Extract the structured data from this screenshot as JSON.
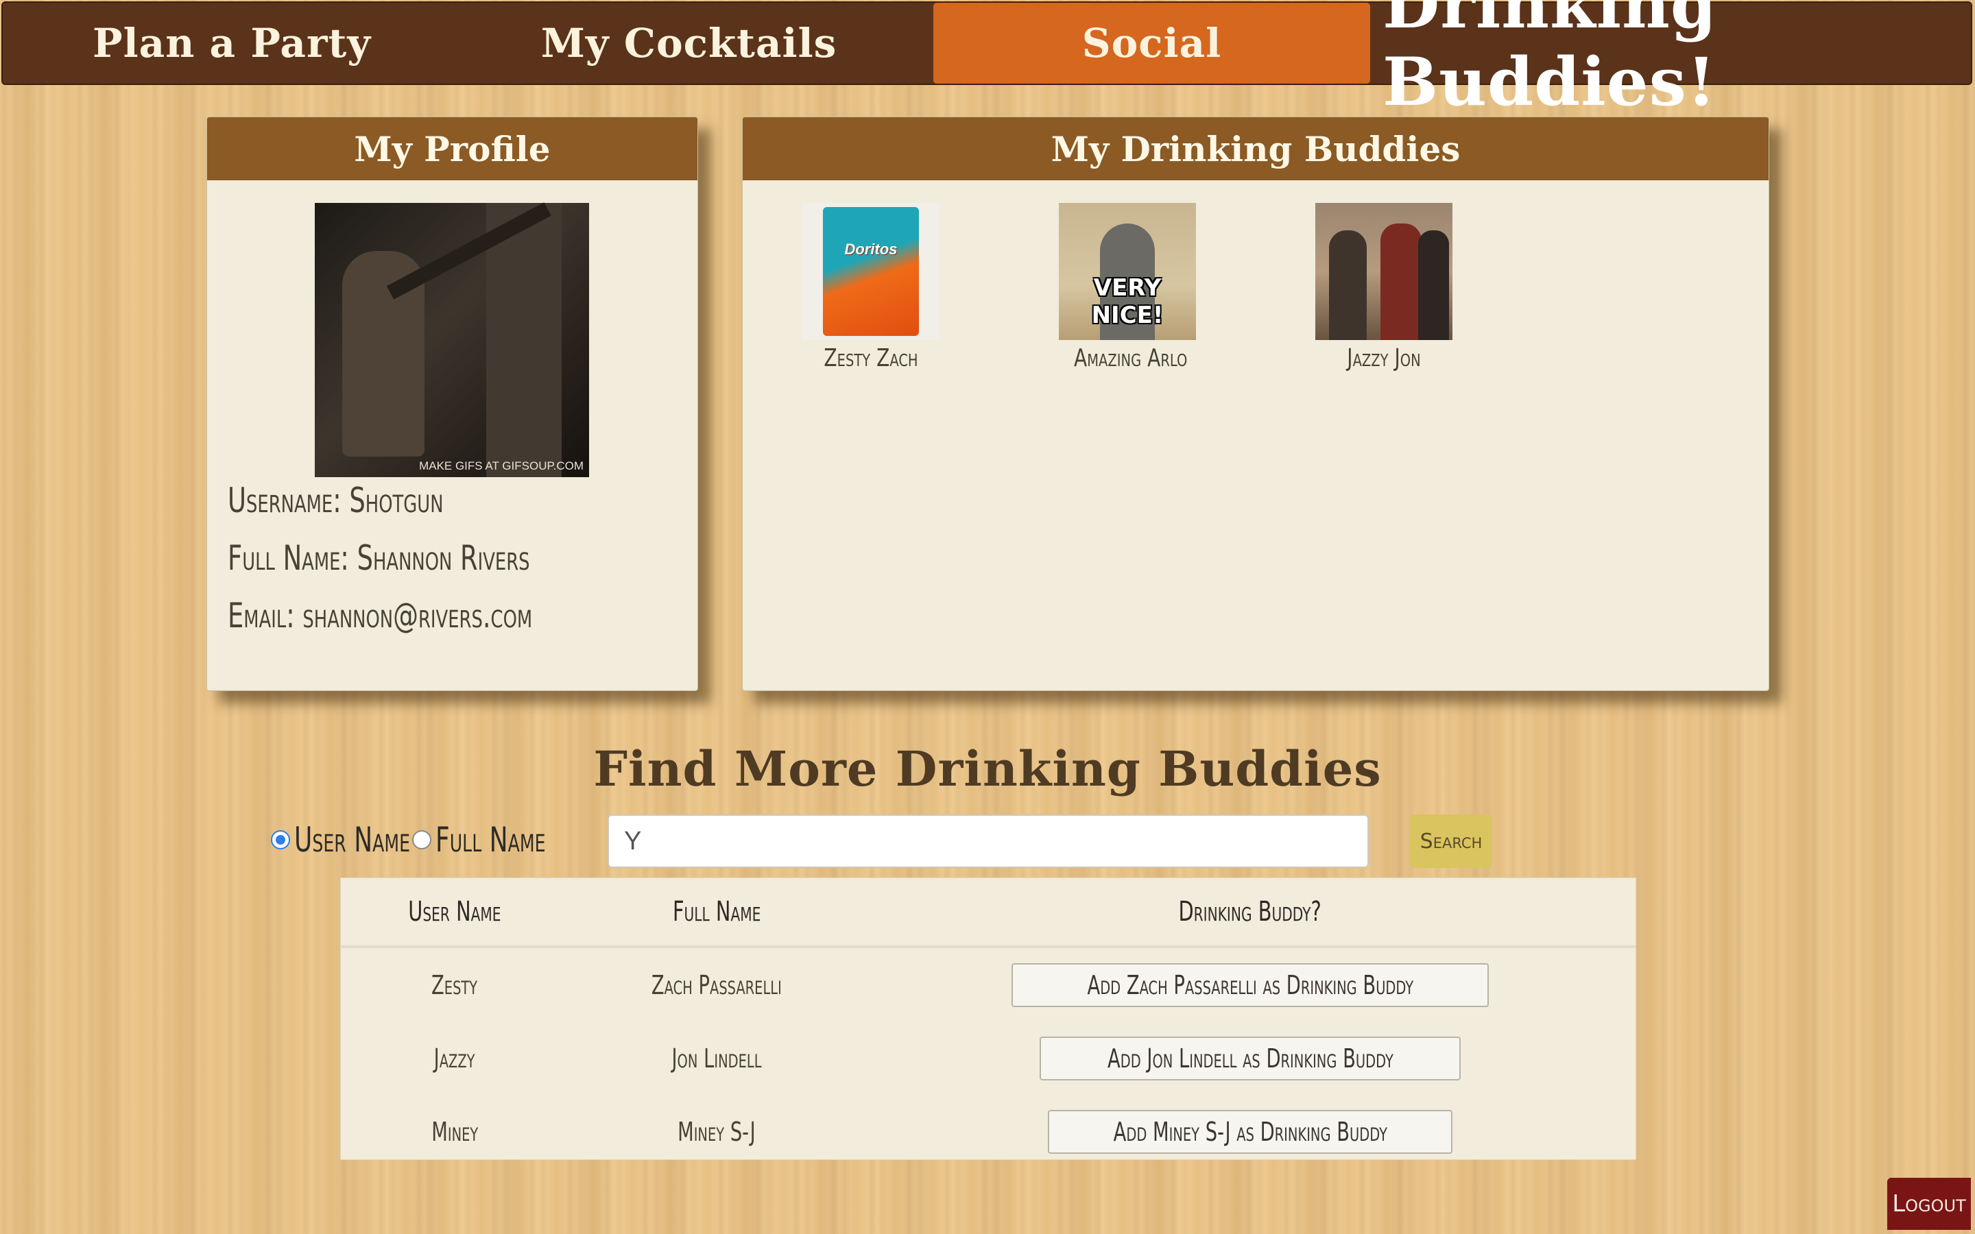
{
  "nav": {
    "items": [
      {
        "label": "Plan a Party"
      },
      {
        "label": "My Cocktails"
      },
      {
        "label": "Social",
        "active": true
      }
    ],
    "brand": "Drinking Buddies!"
  },
  "profile": {
    "title": "My Profile",
    "image_caption": "MAKE GIFS AT GIFSOUP.COM",
    "username_line": "Username: Shotgun",
    "fullname_line": "Full Name: Shannon Rivers",
    "email_line": "Email: shannon@rivers.com"
  },
  "buddies": {
    "title": "My Drinking Buddies",
    "items": [
      {
        "name": "Zesty Zach",
        "image_text": "Doritos"
      },
      {
        "name": "Amazing Arlo",
        "image_text": "VERY NICE!"
      },
      {
        "name": "Jazzy Jon",
        "image_text": ""
      }
    ]
  },
  "find": {
    "title": "Find More Drinking Buddies",
    "radio_username": "User Name",
    "radio_fullname": "Full Name",
    "selected": "username",
    "search_value": "Y",
    "search_button": "Search"
  },
  "results": {
    "headers": [
      "User Name",
      "Full Name",
      "Drinking Buddy?"
    ],
    "rows": [
      {
        "username": "Zesty",
        "fullname": "Zach Passarelli",
        "action": "Add Zach Passarelli as Drinking Buddy"
      },
      {
        "username": "Jazzy",
        "fullname": "Jon Lindell",
        "action": "Add Jon Lindell as Drinking Buddy"
      },
      {
        "username": "Miney",
        "fullname": "Miney S-J",
        "action": "Add Miney S-J as Drinking Buddy"
      }
    ]
  },
  "logout": "Logout",
  "colors": {
    "navbar": "#5b331a",
    "active_tab": "#d5671f",
    "panel_header": "#8b5a25",
    "panel_body": "#f1ecdc",
    "search_button": "#d9c45f",
    "logout": "#7a1515"
  }
}
